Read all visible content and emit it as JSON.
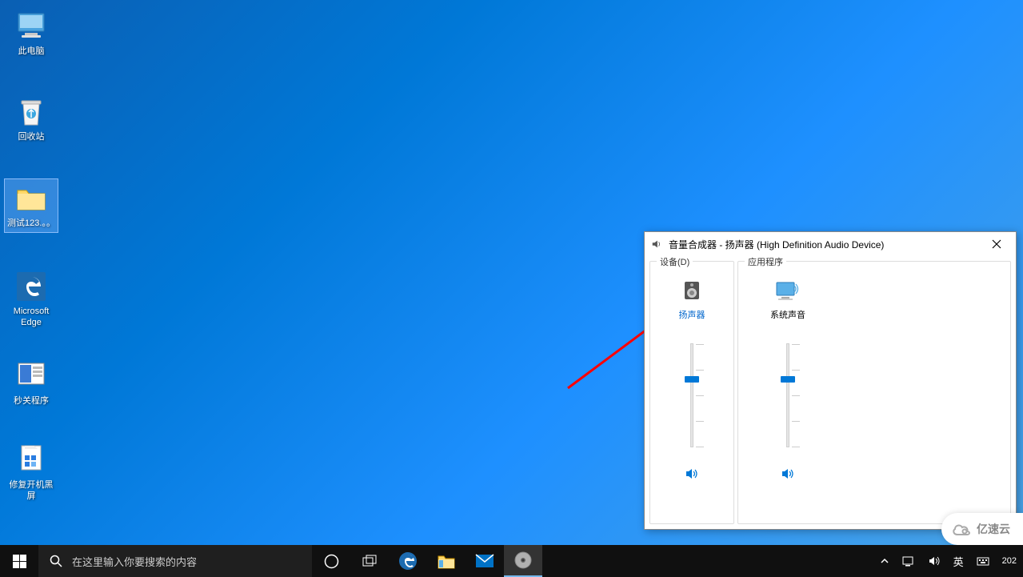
{
  "desktop": {
    "icons": [
      {
        "label": "此电脑"
      },
      {
        "label": "回收站"
      },
      {
        "label": "测试123.。。"
      },
      {
        "label": "Microsoft Edge"
      },
      {
        "label": "秒关程序"
      },
      {
        "label": "修复开机黑屏"
      }
    ]
  },
  "taskbar": {
    "search_placeholder": "在这里输入你要搜索的内容",
    "ime_lang": "英",
    "clock_partial": "202"
  },
  "mixer": {
    "title": "音量合成器 - 扬声器 (High Definition Audio Device)",
    "group_device": "设备(D)",
    "group_apps": "应用程序",
    "device_label": "扬声器",
    "app_label": "系统声音",
    "device_volume_percent": 67,
    "app_volume_percent": 67
  },
  "watermark": "亿速云"
}
